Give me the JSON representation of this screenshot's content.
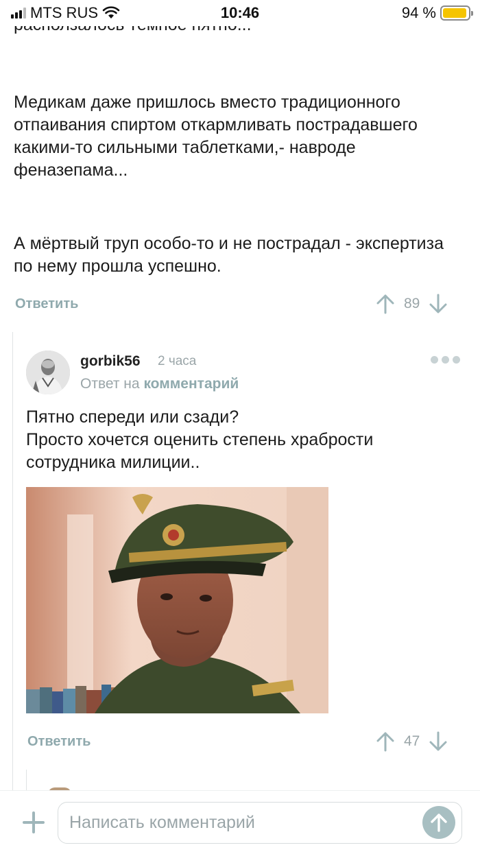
{
  "status_bar": {
    "carrier": "MTS RUS",
    "time": "10:46",
    "battery_percent": "94 %",
    "battery_level": 0.94,
    "battery_color": "#f5c400"
  },
  "post": {
    "clipped_line": "расползалось тёмное пятно...",
    "paragraphs": [
      "Медикам даже пришлось вместо традиционного отпаивания спиртом откармливать пострадавшего какими-то сильными таблетками,- навроде феназепама...",
      "А мёртвый труп особо-то и не пострадал - экспертиза по нему прошла успешно."
    ],
    "reply_label": "Ответить",
    "rating": "89"
  },
  "comment": {
    "author": "gorbik56",
    "time_ago": "2 часа",
    "reply_to_prefix": "Ответ на",
    "reply_to_link": "комментарий",
    "text_lines": [
      "Пятно спереди или сзади?",
      "Просто хочется оценить степень храбрости сотрудника милиции.."
    ],
    "reply_label": "Ответить",
    "rating": "47"
  },
  "composer": {
    "placeholder": "Написать комментарий"
  },
  "icons": {
    "upvote": "arrow-up-icon",
    "downvote": "arrow-down-icon",
    "more": "more-dots-icon",
    "attach": "plus-icon",
    "send": "send-arrow-icon"
  },
  "colors": {
    "accent": "#8fa9ad",
    "muted": "#9aa5a8",
    "send_button": "#a8bfc2"
  }
}
